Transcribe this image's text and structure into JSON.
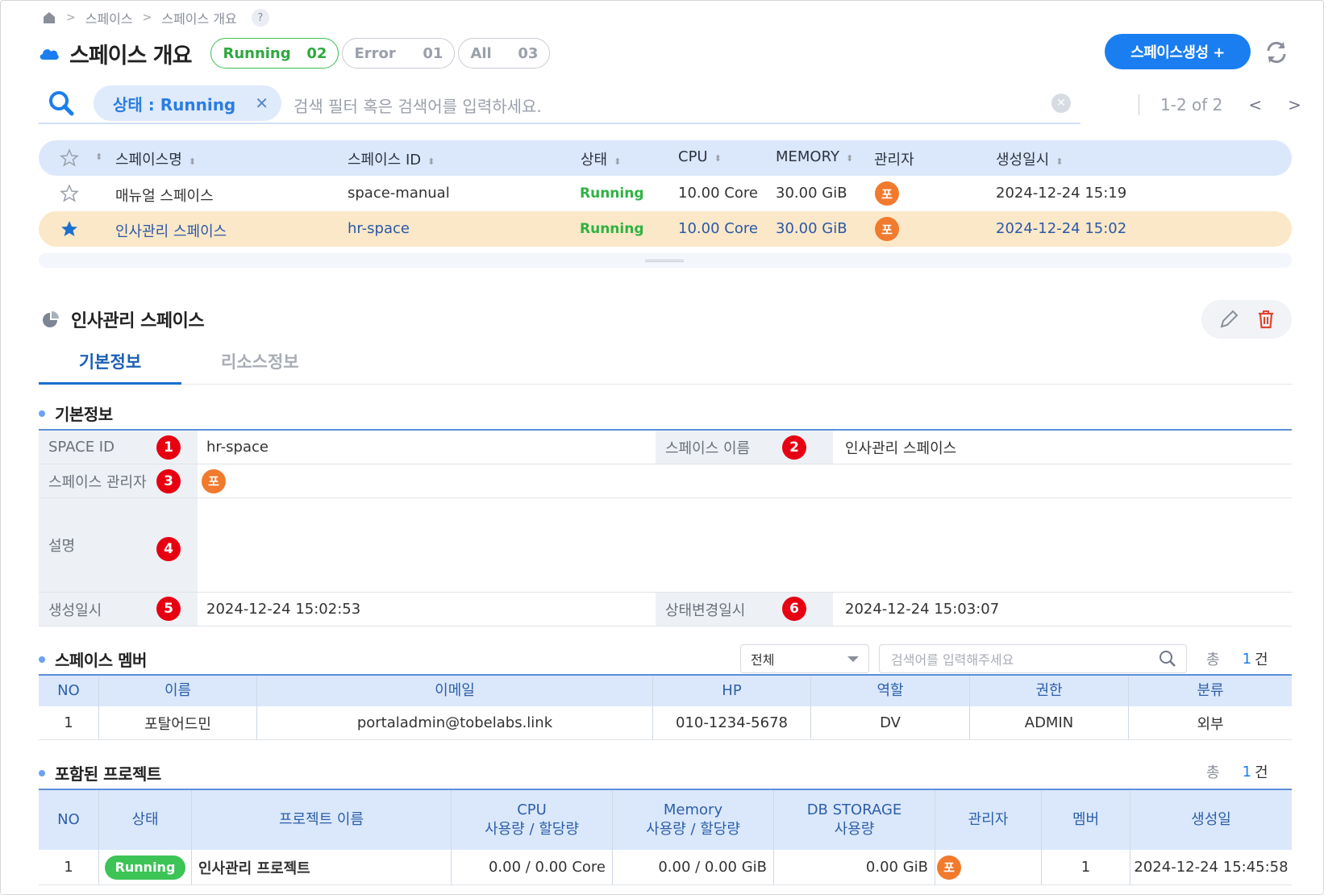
{
  "breadcrumb": {
    "items": [
      "스페이스",
      "스페이스 개요"
    ],
    "help": "?"
  },
  "header": {
    "title": "스페이스 개요",
    "filters": [
      {
        "label": "Running",
        "count": "02"
      },
      {
        "label": "Error",
        "count": "01"
      },
      {
        "label": "All",
        "count": "03"
      }
    ],
    "create_label": "스페이스생성 +"
  },
  "search": {
    "chip_label": "상태 : Running",
    "placeholder": "검색 필터 혹은 검색어를 입력하세요.",
    "pagination": "1-2 of 2"
  },
  "space_table": {
    "columns": [
      "스페이스명",
      "스페이스 ID",
      "상태",
      "CPU",
      "MEMORY",
      "관리자",
      "생성일시"
    ],
    "rows": [
      {
        "name": "매뉴얼 스페이스",
        "id": "space-manual",
        "status": "Running",
        "cpu": "10.00 Core",
        "memory": "30.00 GiB",
        "manager": "포",
        "created": "2024-12-24 15:19"
      },
      {
        "name": "인사관리 스페이스",
        "id": "hr-space",
        "status": "Running",
        "cpu": "10.00 Core",
        "memory": "30.00 GiB",
        "manager": "포",
        "created": "2024-12-24 15:02"
      }
    ]
  },
  "detail": {
    "title": "인사관리 스페이스",
    "tabs": [
      "기본정보",
      "리소스정보"
    ],
    "basic_section": "기본정보",
    "fields": {
      "space_id_label": "SPACE ID",
      "space_id": "hr-space",
      "space_name_label": "스페이스 이름",
      "space_name": "인사관리 스페이스",
      "manager_label": "스페이스 관리자",
      "manager": "포",
      "desc_label": "설명",
      "desc": "",
      "created_label": "생성일시",
      "created": "2024-12-24 15:02:53",
      "status_changed_label": "상태변경일시",
      "status_changed": "2024-12-24 15:03:07"
    },
    "badges": [
      "1",
      "2",
      "3",
      "4",
      "5",
      "6"
    ]
  },
  "members": {
    "title": "스페이스 멤버",
    "filter_value": "전체",
    "search_placeholder": "검색어를 입력해주세요",
    "count_prefix": "총",
    "count": "1",
    "count_unit": "건",
    "columns": [
      "NO",
      "이름",
      "이메일",
      "HP",
      "역할",
      "권한",
      "분류"
    ],
    "rows": [
      {
        "no": "1",
        "name": "포탈어드민",
        "email": "portaladmin@tobelabs.link",
        "hp": "010-1234-5678",
        "role": "DV",
        "perm": "ADMIN",
        "type": "외부"
      }
    ]
  },
  "projects": {
    "title": "포함된 프로젝트",
    "count_prefix": "총",
    "count": "1",
    "count_unit": "건",
    "columns": [
      "NO",
      "상태",
      "프로젝트 이름",
      "CPU",
      "Memory",
      "DB STORAGE",
      "관리자",
      "멤버",
      "생성일"
    ],
    "subcolumns": {
      "cpu": "사용량 / 할당량",
      "memory": "사용량 / 할당량",
      "db": "사용량"
    },
    "rows": [
      {
        "no": "1",
        "status": "Running",
        "name": "인사관리 프로젝트",
        "cpu": "0.00 / 0.00 Core",
        "memory": "0.00 / 0.00 GiB",
        "db": "0.00 GiB",
        "manager": "포",
        "members": "1",
        "created": "2024-12-24 15:45:58"
      }
    ]
  },
  "colors": {
    "accent": "#1a7ef0",
    "running": "#2fb344",
    "avatar": "#f17a2d",
    "badge": "#e60012",
    "selected_row": "#fbe8c8",
    "header_bg": "#dbe8fb"
  }
}
